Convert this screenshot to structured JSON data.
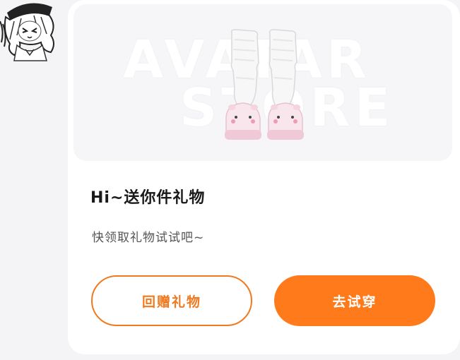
{
  "avatar": {
    "icon": "anime-girl-avatar-icon"
  },
  "hero": {
    "watermark_line1": "AVATAR",
    "watermark_line2": "STORE",
    "item_icon": "socks-slippers-icon"
  },
  "title": "Hi~送你件礼物",
  "subtitle": "快领取礼物试试吧~",
  "buttons": {
    "gift_label": "回赠礼物",
    "try_label": "去试穿"
  },
  "colors": {
    "accent": "#ff7a1a",
    "accent_border": "#f07a20",
    "title_text": "#1a1a1a",
    "subtitle_text": "#555555",
    "hero_bg": "#f6f6f9"
  }
}
